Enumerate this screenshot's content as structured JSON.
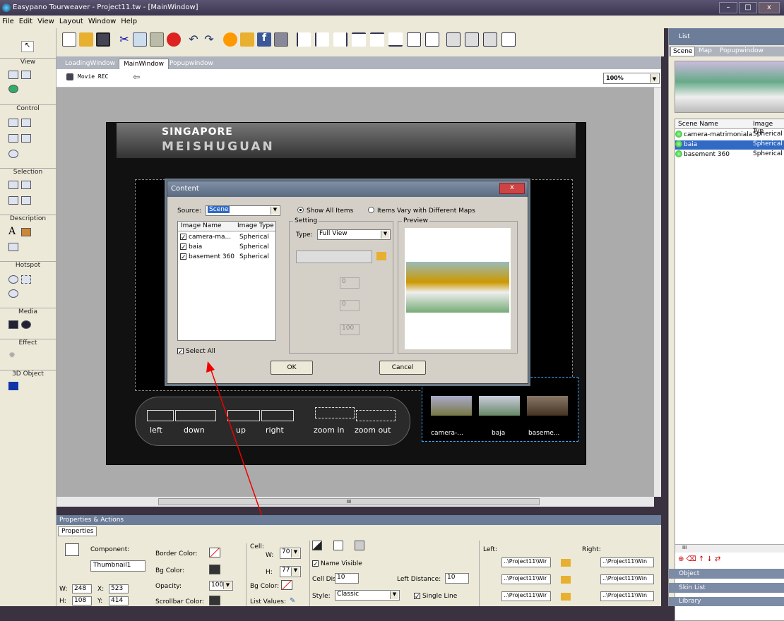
{
  "window": {
    "title": "Easypano Tourweaver - Project11.tw - [MainWindow]",
    "min": "–",
    "max": "□",
    "close": "x"
  },
  "menu": [
    "File",
    "Edit",
    "View",
    "Layout",
    "Window",
    "Help"
  ],
  "toolbar_icons": [
    "new-icon",
    "open-icon",
    "save-icon",
    "cut-icon",
    "copy-icon",
    "paste-icon",
    "delete-icon",
    "undo-icon",
    "redo-icon",
    "preview-icon",
    "publish-icon",
    "facebook-icon",
    "export-icon",
    "align-left-icon",
    "align-center-icon",
    "align-right-icon",
    "align-top-icon",
    "align-middle-icon",
    "align-bottom-icon",
    "distribute-h-icon",
    "distribute-v-icon",
    "same-width-icon",
    "same-height-icon",
    "same-size-icon",
    "grid-icon"
  ],
  "left_panel": {
    "groups": [
      {
        "label": "View"
      },
      {
        "label": "Control"
      },
      {
        "label": "Selection"
      },
      {
        "label": "Description"
      },
      {
        "label": "Hotspot"
      },
      {
        "label": "Media"
      },
      {
        "label": "Effect"
      },
      {
        "label": "3D Object"
      }
    ]
  },
  "tabs": [
    "LoadingWindow",
    "MainWindow",
    "Popupwindow"
  ],
  "subbar": {
    "movie_rec": "Movie REC",
    "zoom": "100%"
  },
  "skin": {
    "title1": "SINGAPORE",
    "title2": "MEISHUGUAN",
    "controls": [
      "left",
      "down",
      "up",
      "right",
      "zoom in",
      "zoom out"
    ],
    "thumbs": [
      "camera-...",
      "baja",
      "baseme..."
    ]
  },
  "dialog": {
    "title": "Content",
    "close": "x",
    "source_label": "Source:",
    "source_value": "Scene",
    "table_headers": [
      "Image Name",
      "Image Type"
    ],
    "rows": [
      {
        "name": "camera-ma...",
        "type": "Spherical"
      },
      {
        "name": "baia",
        "type": "Spherical"
      },
      {
        "name": "basement 360",
        "type": "Spherical"
      }
    ],
    "show_all": "Show All Items",
    "vary": "Items Vary with Different Maps",
    "setting": "Setting",
    "type_label": "Type:",
    "type_value": "Full View",
    "num1": "0",
    "num2": "0",
    "num3": "100",
    "preview": "Preview",
    "select_all": "Select All",
    "ok": "OK",
    "cancel": "Cancel"
  },
  "right_panel": {
    "header": "List",
    "tabs": [
      "Scene",
      "Map",
      "Popupwindow"
    ],
    "col_headers": [
      "Scene Name",
      "Image Typ"
    ],
    "rows": [
      {
        "name": "camera-matrimoniala",
        "type": "Spherical"
      },
      {
        "name": "baia",
        "type": "Spherical"
      },
      {
        "name": "basement 360",
        "type": "Spherical"
      }
    ],
    "scroll_label": "III",
    "bottom": [
      "Object",
      "Skin List",
      "Library"
    ]
  },
  "properties": {
    "header": "Properties & Actions",
    "tab": "Properties",
    "component_label": "Component:",
    "component_value": "Thumbnail1",
    "w_label": "W:",
    "w_value": "248",
    "x_label": "X:",
    "x_value": "523",
    "h_label": "H:",
    "h_value": "108",
    "y_label": "Y:",
    "y_value": "414",
    "border_color": "Border Color:",
    "bg_color": "Bg Color:",
    "opacity": "Opacity:",
    "opacity_value": "100",
    "scrollbar_color": "Scrollbar Color:",
    "cell": "Cell:",
    "cell_w_label": "W:",
    "cell_w": "70",
    "cell_h_label": "H:",
    "cell_h": "77",
    "cell_bg": "Bg Color:",
    "list_values": "List Values:",
    "name_visible": "Name Visible",
    "cell_distance": "Cell Distance:",
    "cell_distance_value": "10",
    "left_distance": "Left Distance:",
    "left_distance_value": "10",
    "style": "Style:",
    "style_value": "Classic",
    "single_line": "Single Line",
    "left": "Left:",
    "right": "Right:",
    "path": "..\\Project11\\Wir",
    "path_r": "..\\Project11\\Win"
  },
  "hscroll_label": "III"
}
